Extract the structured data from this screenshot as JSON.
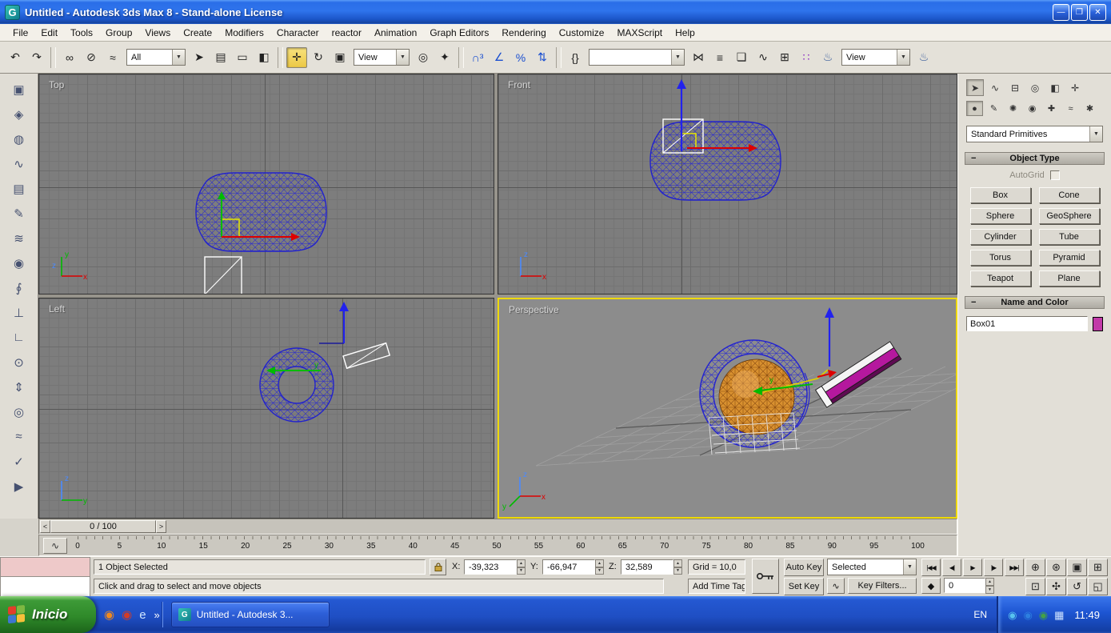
{
  "window": {
    "title": "Untitled - Autodesk 3ds Max 8  - Stand-alone License",
    "app_icon_glyph": "G",
    "controls": [
      {
        "name": "minimize-button",
        "glyph": "—"
      },
      {
        "name": "maximize-button",
        "glyph": "❐"
      },
      {
        "name": "close-button",
        "glyph": "✕"
      }
    ]
  },
  "menubar": {
    "items": [
      "File",
      "Edit",
      "Tools",
      "Group",
      "Views",
      "Create",
      "Modifiers",
      "Character",
      "reactor",
      "Animation",
      "Graph Editors",
      "Rendering",
      "Customize",
      "MAXScript",
      "Help"
    ]
  },
  "toolbar": {
    "g1": [
      {
        "name": "undo-icon",
        "glyph": "↶"
      },
      {
        "name": "redo-icon",
        "glyph": "↷"
      }
    ],
    "g2": [
      {
        "name": "select-and-link-icon",
        "glyph": "∞"
      },
      {
        "name": "unlink-selection-icon",
        "glyph": "⊘"
      },
      {
        "name": "bind-to-space-warp-icon",
        "glyph": "≈"
      }
    ],
    "selection_filter_value": "All",
    "g3": [
      {
        "name": "select-object-icon",
        "glyph": "➤"
      },
      {
        "name": "select-by-name-icon",
        "glyph": "▤"
      },
      {
        "name": "rectangular-selection-region-icon",
        "glyph": "▭"
      },
      {
        "name": "window-crossing-selection-icon",
        "glyph": "◧"
      }
    ],
    "g4": [
      {
        "name": "select-and-move-icon",
        "glyph": "✛",
        "active": true
      },
      {
        "name": "select-and-rotate-icon",
        "glyph": "↻"
      },
      {
        "name": "select-and-uniform-scale-icon",
        "glyph": "▣"
      }
    ],
    "ref_coord_value": "View",
    "g5": [
      {
        "name": "use-pivot-point-center-icon",
        "glyph": "◎"
      },
      {
        "name": "select-and-manipulate-icon",
        "glyph": "✦"
      }
    ],
    "g6": [
      {
        "name": "snaps-toggle-3d-icon",
        "glyph": "∩³",
        "color": "#1a4fd0"
      },
      {
        "name": "angle-snap-toggle-icon",
        "glyph": "∠",
        "color": "#1a4fd0"
      },
      {
        "name": "percent-snap-toggle-icon",
        "glyph": "%",
        "color": "#1a4fd0"
      },
      {
        "name": "spinner-snap-toggle-icon",
        "glyph": "⇅",
        "color": "#1a4fd0"
      }
    ],
    "g7": [
      {
        "name": "edit-named-selection-sets-icon",
        "glyph": "{}"
      }
    ],
    "named_selection_value": "",
    "g8": [
      {
        "name": "mirror-icon",
        "glyph": "⋈"
      },
      {
        "name": "align-icon",
        "glyph": "≡"
      },
      {
        "name": "layer-manager-icon",
        "glyph": "❏"
      },
      {
        "name": "curve-editor-icon",
        "glyph": "∿"
      },
      {
        "name": "schematic-view-icon",
        "glyph": "⊞"
      },
      {
        "name": "material-editor-icon",
        "glyph": "∷",
        "color": "#8a2ac0"
      },
      {
        "name": "render-scene-icon",
        "glyph": "♨",
        "color": "#355a9a"
      }
    ],
    "render_type_value": "View",
    "g9": [
      {
        "name": "quick-render-icon",
        "glyph": "♨",
        "color": "#355a9a"
      }
    ]
  },
  "reactor_toolbar": {
    "icons": [
      {
        "name": "rigid-body-collection-icon",
        "glyph": "▣"
      },
      {
        "name": "cloth-collection-icon",
        "glyph": "◈"
      },
      {
        "name": "soft-body-collection-icon",
        "glyph": "◍"
      },
      {
        "name": "rope-collection-icon",
        "glyph": "∿"
      },
      {
        "name": "deforming-mesh-collection-icon",
        "glyph": "▤"
      },
      {
        "name": "cloth-modifier-icon",
        "glyph": "✎"
      },
      {
        "name": "rope-modifier-icon",
        "glyph": "≋"
      },
      {
        "name": "soft-body-modifier-icon",
        "glyph": "◉"
      },
      {
        "name": "spring-icon",
        "glyph": "∮"
      },
      {
        "name": "dashpot-icon",
        "glyph": "⊥"
      },
      {
        "name": "hinge-constraint-icon",
        "glyph": "∟"
      },
      {
        "name": "point-point-constraint-icon",
        "glyph": "⊙"
      },
      {
        "name": "prismatic-constraint-icon",
        "glyph": "⇕"
      },
      {
        "name": "car-wheel-constraint-icon",
        "glyph": "◎"
      },
      {
        "name": "wind-icon",
        "glyph": "≈"
      },
      {
        "name": "analyze-world-icon",
        "glyph": "✓"
      },
      {
        "name": "preview-animation-icon",
        "glyph": "▶"
      }
    ]
  },
  "viewports": {
    "top": {
      "label": "Top"
    },
    "front": {
      "label": "Front"
    },
    "left": {
      "label": "Left"
    },
    "perspective": {
      "label": "Perspective"
    },
    "axes": {
      "x": "x",
      "y": "y",
      "z": "z"
    }
  },
  "colors": {
    "active_viewport_border": "#eed900",
    "wireframe_blue": "#2525cf",
    "sphere_orange": "#d8902f",
    "box_magenta": "#b5189e",
    "object_swatch": "#c23aa8"
  },
  "command_panel": {
    "tabs": [
      {
        "name": "tab-create-icon",
        "glyph": "➤",
        "active": true
      },
      {
        "name": "tab-modify-icon",
        "glyph": "∿"
      },
      {
        "name": "tab-hierarchy-icon",
        "glyph": "⊟"
      },
      {
        "name": "tab-motion-icon",
        "glyph": "◎"
      },
      {
        "name": "tab-display-icon",
        "glyph": "◧"
      },
      {
        "name": "tab-utilities-icon",
        "glyph": "✛"
      }
    ],
    "categories": [
      {
        "name": "category-geometry-icon",
        "glyph": "●",
        "active": true
      },
      {
        "name": "category-shapes-icon",
        "glyph": "✎"
      },
      {
        "name": "category-lights-icon",
        "glyph": "✺"
      },
      {
        "name": "category-cameras-icon",
        "glyph": "◉"
      },
      {
        "name": "category-helpers-icon",
        "glyph": "✚"
      },
      {
        "name": "category-space-warps-icon",
        "glyph": "≈"
      },
      {
        "name": "category-systems-icon",
        "glyph": "✱"
      }
    ],
    "category_dropdown_value": "Standard Primitives",
    "object_type_title": "Object Type",
    "rollout_collapse_glyph": "−",
    "autogrid_label": "AutoGrid",
    "object_buttons": [
      "Box",
      "Cone",
      "Sphere",
      "GeoSphere",
      "Cylinder",
      "Tube",
      "Torus",
      "Pyramid",
      "Teapot",
      "Plane"
    ],
    "name_color_title": "Name and Color",
    "object_name_value": "Box01"
  },
  "timeline": {
    "slider_value": "0 / 100",
    "step_back_glyph": "<",
    "step_forward_glyph": ">",
    "mini_curve_editor_glyph": "∿",
    "ticks": [
      "0",
      "5",
      "10",
      "15",
      "20",
      "25",
      "30",
      "35",
      "40",
      "45",
      "50",
      "55",
      "60",
      "65",
      "70",
      "75",
      "80",
      "85",
      "90",
      "95",
      "100"
    ]
  },
  "status": {
    "selection_status": "1 Object Selected",
    "x_label": "X:",
    "y_label": "Y:",
    "z_label": "Z:",
    "x_value": "-39,323",
    "y_value": "-66,947",
    "z_value": "32,589",
    "grid_value": "Grid = 10,0",
    "prompt": "Click and drag to select and move objects",
    "add_time_tag": "Add Time Tag"
  },
  "anim": {
    "auto_key": "Auto Key",
    "set_key": "Set Key",
    "selected_value": "Selected",
    "tangent_glyph": "∿",
    "key_filters": "Key Filters...",
    "transport": [
      {
        "name": "go-to-start-button",
        "glyph": "|◀◀"
      },
      {
        "name": "previous-frame-button",
        "glyph": "◀|"
      },
      {
        "name": "play-button",
        "glyph": "▶"
      },
      {
        "name": "next-frame-button",
        "glyph": "|▶"
      },
      {
        "name": "go-to-end-button",
        "glyph": "▶▶|"
      }
    ],
    "key_mode_glyph": "◆",
    "frame_value": "0"
  },
  "nav": {
    "row1": [
      {
        "name": "zoom-icon",
        "glyph": "⊕"
      },
      {
        "name": "zoom-all-icon",
        "glyph": "⊛"
      },
      {
        "name": "zoom-extents-icon",
        "glyph": "▣"
      },
      {
        "name": "zoom-extents-all-icon",
        "glyph": "⊞"
      }
    ],
    "row2": [
      {
        "name": "zoom-region-icon",
        "glyph": "⊡"
      },
      {
        "name": "pan-icon",
        "glyph": "✣"
      },
      {
        "name": "arc-rotate-icon",
        "glyph": "↺"
      },
      {
        "name": "maximize-viewport-toggle-icon",
        "glyph": "◱"
      }
    ]
  },
  "taskbar": {
    "start_label": "Inicio",
    "quick_launch": [
      {
        "name": "firefox-icon",
        "glyph": "◉",
        "color": "#f08a1e"
      },
      {
        "name": "quick-launch-icon-2",
        "glyph": "◉",
        "color": "#d23c28"
      },
      {
        "name": "internet-explorer-icon",
        "glyph": "e",
        "color": "#cfe6ff"
      }
    ],
    "overflow_glyph": "»",
    "task_button": {
      "label": "Untitled - Autodesk 3...",
      "icon_glyph": "G"
    },
    "language_indicator": "EN",
    "tray_icons": [
      {
        "name": "tray-icon-1",
        "glyph": "◉",
        "color": "#57c2ef"
      },
      {
        "name": "tray-icon-2",
        "glyph": "◉",
        "color": "#2d7fe0"
      },
      {
        "name": "tray-icon-3",
        "glyph": "◉",
        "color": "#43a047"
      },
      {
        "name": "tray-icon-4",
        "glyph": "▦",
        "color": "#cfe3ff"
      }
    ],
    "clock": "11:49"
  }
}
